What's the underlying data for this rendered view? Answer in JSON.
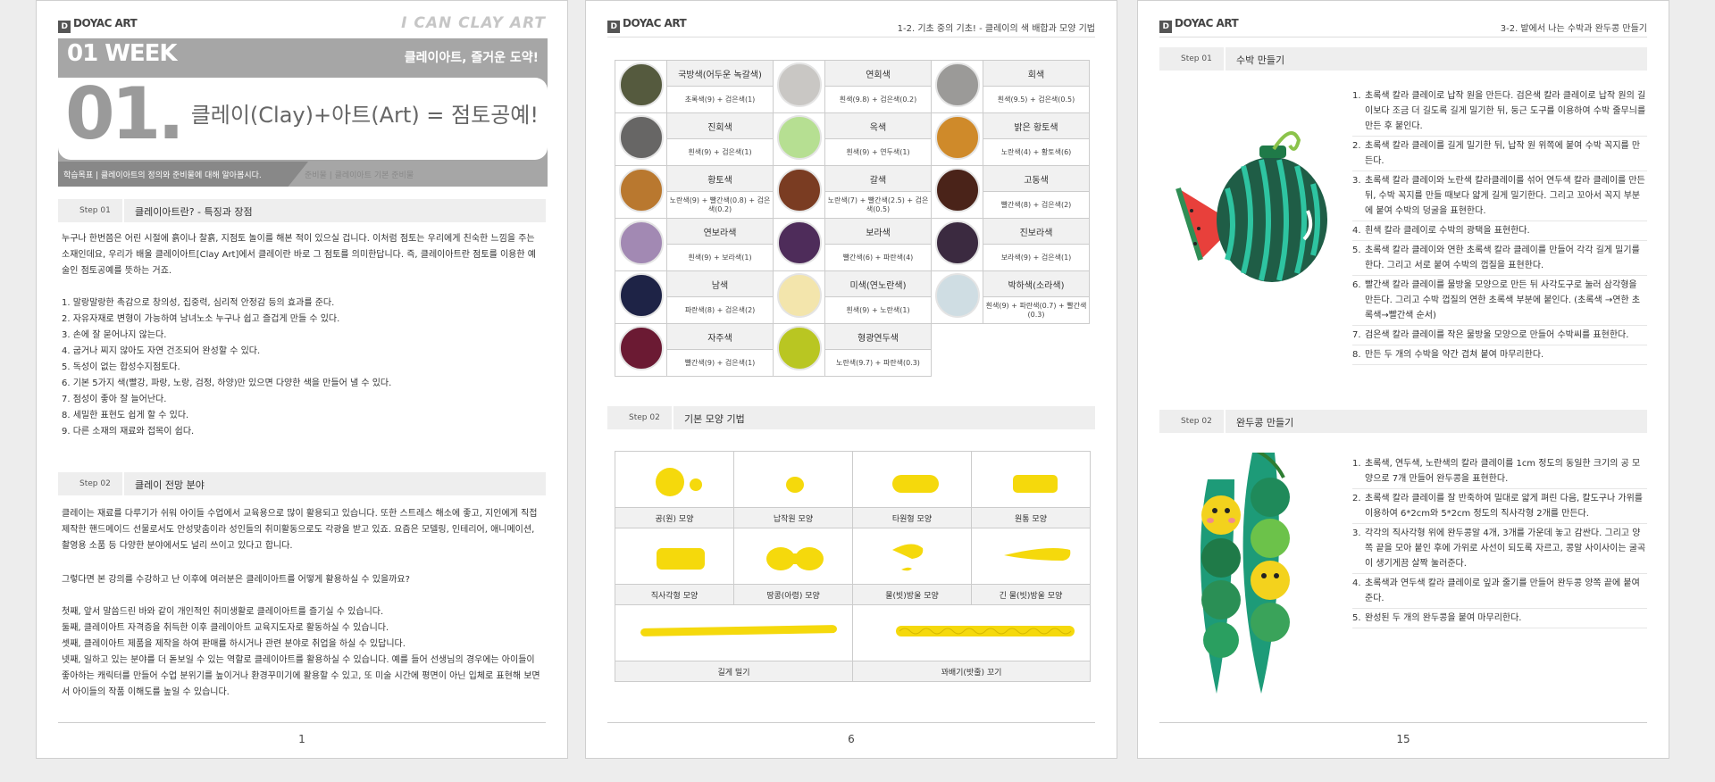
{
  "logo": "DOYAC ART",
  "page1": {
    "brand": "I CAN CLAY ART",
    "week": "01 WEEK",
    "week_sub": "클레이아트, 즐거운 도약!",
    "big_num": "01.",
    "formula": "클레이(Clay)+아트(Art) = 점토공예!",
    "goal": "학습목표 | 클레이아트의 정의와 준비물에 대해 알아봅시다.",
    "goal2": "준비물 | 클레이아트 기본 준비물",
    "step1": {
      "tag": "Step 01",
      "title": "클레이아트란? - 특징과 장점"
    },
    "intro": "누구나 한번쯤은 어린 시절에 흙이나 찰흙, 지점토 놀이를 해본 적이 있으실 겁니다. 이처럼 점토는 우리에게 친숙한 느낌을 주는 소재인데요, 우리가 배울 클레이아트[Clay Art]에서 클레이란 바로 그 점토를 의미한답니다. 즉, 클레이아트란 점토를 이용한 예술인 점토공예를 뜻하는 거죠.",
    "features": [
      "1. 말랑말랑한 촉감으로 창의성, 집중력, 심리적 안정감 등의 효과를 준다.",
      "2. 자유자재로 변형이 가능하여 남녀노소 누구나 쉽고 즐겁게 만들 수 있다.",
      "3. 손에 잘 묻어나지 않는다.",
      "4. 굽거나 찌지 않아도 자연 건조되어 완성할 수 있다.",
      "5. 독성이 없는 합성수지점토다.",
      "6. 기본 5가지 색(빨강, 파랑, 노랑, 검정, 하양)만 있으면 다양한 색을 만들어 낼 수 있다.",
      "7. 점성이 좋아 잘 늘어난다.",
      "8. 세밀한 표현도 쉽게 할 수 있다.",
      "9. 다른 소재의 재료와 접목이 쉽다."
    ],
    "step2": {
      "tag": "Step 02",
      "title": "클레이 전망 분야"
    },
    "outlook": "클레이는 재료를 다루기가 쉬워 아이들 수업에서 교육용으로 많이 활용되고 있습니다. 또한 스트레스 해소에 좋고, 지인에게 직접 제작한 핸드메이드 선물로서도 안성맞춤이라 성인들의 취미활동으로도 각광을 받고 있죠. 요즘은 모델링, 인테리어, 애니메이션, 촬영용 소품 등 다양한 분야에서도 널리 쓰이고 있다고 합니다.",
    "question": "그렇다면 본 강의를 수강하고 난 이후에 여러분은 클레이아트를 어떻게 활용하실 수 있을까요?",
    "uses": [
      "첫째, 앞서 말씀드린 바와 같이 개인적인 취미생활로 클레이아트를 즐기실 수 있습니다.",
      "둘째, 클레이아트 자격증을 취득한 이후 클레이아트 교육지도자로 활동하실 수 있습니다.",
      "셋째, 클레이아트 제품을 제작을 하여 판매를 하시거나 관련 분야로 취업을 하실 수 있답니다.",
      "넷째, 일하고 있는 분야를 더 돋보일 수 있는 역할로 클레이아트를 활용하실 수 있습니다. 예를 들어 선생님의 경우에는 아이들이 좋아하는 캐릭터를 만들어 수업 분위기를 높이거나 환경꾸미기에 활용할 수 있고, 또 미술 시간에 평면이 아닌 입체로 표현해 보면서 아이들의 작품 이해도를 높일 수 있습니다."
    ],
    "page_no": "1"
  },
  "page2": {
    "header": "1-2. 기초 중의 기초! - 클레이의 색 배합과 모양 기법",
    "colors": [
      [
        {
          "name": "국방색(어두운 녹갈색)",
          "recipe": "초록색(9) + 검은색(1)",
          "color": "#555a3e"
        },
        {
          "name": "연회색",
          "recipe": "흰색(9.8) + 검은색(0.2)",
          "color": "#c9c7c4"
        },
        {
          "name": "회색",
          "recipe": "흰색(9.5) + 검은색(0.5)",
          "color": "#9b9a98"
        }
      ],
      [
        {
          "name": "진회색",
          "recipe": "흰색(9) + 검은색(1)",
          "color": "#676665"
        },
        {
          "name": "옥색",
          "recipe": "흰색(9) + 연두색(1)",
          "color": "#b6df92"
        },
        {
          "name": "밝은 황토색",
          "recipe": "노란색(4) + 황토색(6)",
          "color": "#cf8a2a"
        }
      ],
      [
        {
          "name": "황토색",
          "recipe": "노란색(9) + 빨간색(0.8) + 검은색(0.2)",
          "color": "#b9782f"
        },
        {
          "name": "갈색",
          "recipe": "노란색(7) + 빨간색(2.5) + 검은색(0.5)",
          "color": "#7a3c22"
        },
        {
          "name": "고동색",
          "recipe": "빨간색(8) + 검은색(2)",
          "color": "#4a2319"
        }
      ],
      [
        {
          "name": "연보라색",
          "recipe": "흰색(9) + 보라색(1)",
          "color": "#a289b3"
        },
        {
          "name": "보라색",
          "recipe": "빨간색(6) + 파란색(4)",
          "color": "#4e2c5a"
        },
        {
          "name": "진보라색",
          "recipe": "보라색(9) + 검은색(1)",
          "color": "#3b2a40"
        }
      ],
      [
        {
          "name": "남색",
          "recipe": "파란색(8) + 검은색(2)",
          "color": "#1e2346"
        },
        {
          "name": "미색(연노란색)",
          "recipe": "흰색(9) + 노란색(1)",
          "color": "#f3e5ac"
        },
        {
          "name": "박하색(소라색)",
          "recipe": "흰색(9) + 파란색(0.7) + 빨간색(0.3)",
          "color": "#cfdde3"
        }
      ],
      [
        {
          "name": "자주색",
          "recipe": "빨간색(9) + 검은색(1)",
          "color": "#6b1a33"
        },
        {
          "name": "형광연두색",
          "recipe": "노란색(9.7) + 파란색(0.3)",
          "color": "#b9c622"
        }
      ]
    ],
    "step2": {
      "tag": "Step 02",
      "title": "기본 모양 기법"
    },
    "shapes_row1": [
      "공(원) 모양",
      "납작원 모양",
      "타원형 모양",
      "원통 모양"
    ],
    "shapes_row2": [
      "직사각형 모양",
      "땅콩(아령) 모양",
      "물(빗)방울 모양",
      "긴 물(빗)방울 모양"
    ],
    "shapes_row3": [
      "길게 밀기",
      "꽈배기(밧줄) 꼬기"
    ],
    "clay_color": "#f5d90c",
    "page_no": "6"
  },
  "page3": {
    "header": "3-2. 밭에서 나는 수박과 완두콩 만들기",
    "step1": {
      "tag": "Step 01",
      "title": "수박 만들기"
    },
    "watermelon_steps": [
      "초록색 칼라 클레이로 납작 원을 만든다. 검은색 칼라 클레이로 납작 원의 길이보다 조금 더 길도록 길게 밀기한 뒤, 둥근 도구를 이용하여 수박 줄무늬를 만든 후 붙인다.",
      "초록색 칼라 클레이를 길게 밀기한 뒤, 납작 원 위쪽에 붙여 수박 꼭지를 만든다.",
      "초록색 칼라 클레이와 노란색 칼라클레이를 섞어 연두색 칼라 클레이를 만든 뒤, 수박 꼭지를 만들 때보다 얇게 길게 밀기한다. 그리고 꼬아서 꼭지 부분에 붙여 수박의 덩굴을 표현한다.",
      "흰색 칼라 클레이로 수박의 광택을 표현한다.",
      "초록색 칼라 클레이와 연한 초록색 칼라 클레이를 만들어 각각 길게 밀기를 한다. 그리고 서로 붙여 수박의 껍질을 표현한다.",
      "빨간색 칼라 클레이를 물방울 모양으로 만든 뒤 사각도구로 눌러 삼각형을 만든다. 그리고 수박 껍질의 연한 초록색 부분에 붙인다. (초록색 →연한 초록색→빨간색 순서)",
      "검은색 칼라 클레이를 작은 물방울 모양으로 만들어 수박씨를 표현한다.",
      "만든 두 개의 수박을 약간 겹쳐 붙여 마무리한다."
    ],
    "step2": {
      "tag": "Step 02",
      "title": "완두콩 만들기"
    },
    "pea_steps": [
      "초록색, 연두색, 노란색의 칼라 클레이를 1cm 정도의 동일한 크기의 공 모양으로 7개 만들어 완두콩을 표현한다.",
      "초록색 칼라 클레이를 잘 반죽하여 밀대로 얇게 펴린 다음, 칼도구나 가위를 이용하여 6*2cm와 5*2cm 정도의 직사각형 2개를 만든다.",
      "각각의 직사각형 위에 완두콩알 4개, 3개를 가운데 놓고 감싼다. 그리고 양쪽 끝을 모아 붙인 후에 가위로 사선이 되도록 자르고, 콩알 사이사이는 굴곡이 생기게끔 살짝 눌러준다.",
      "초록색과 연두색 칼라 클레이로 잎과 줄기를 만들어 완두콩 양쪽 끝에 붙여준다.",
      "완성된 두 개의 완두콩을 붙여 마무리한다."
    ],
    "page_no": "15"
  }
}
